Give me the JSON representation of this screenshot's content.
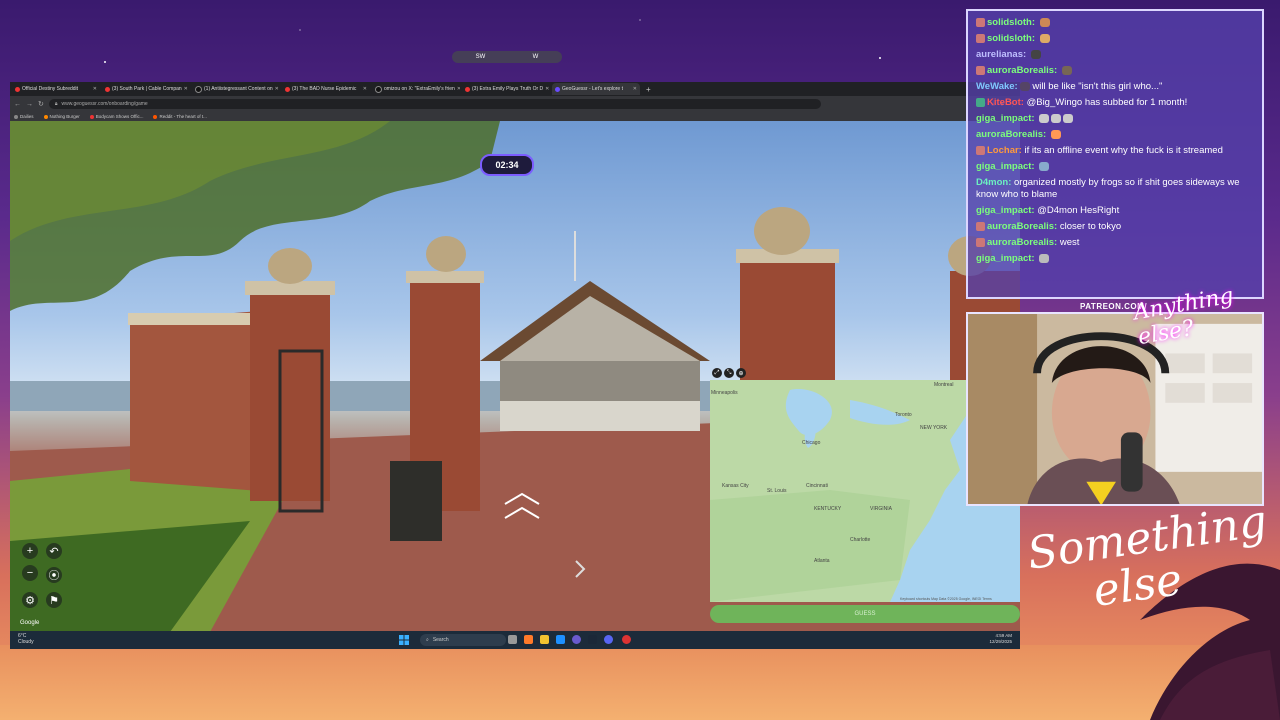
{
  "browser": {
    "tabs": [
      {
        "label": "Official Destiny Subreddit"
      },
      {
        "label": "(3) South Park | Cable Compan"
      },
      {
        "label": "(1) Antiistegressant Content on"
      },
      {
        "label": "(3) The BAD Nurse Epidemic"
      },
      {
        "label": "omizou on X: \"ExtraEmily's frien"
      },
      {
        "label": "(3) Extra Emily Plays Truth Or D"
      },
      {
        "label": "GeoGuessr - Let's explore t"
      }
    ],
    "url": "www.geoguessr.com/onboarding/game",
    "bookmarks": [
      {
        "label": "Dailies"
      },
      {
        "label": "Nothing Burger"
      },
      {
        "label": "Bodycam Shows Offic..."
      },
      {
        "label": "Reddit - The heart of t..."
      }
    ]
  },
  "game": {
    "compass_label": "SW",
    "compass_right": "W",
    "timer": "02:34",
    "guess_label": "GUESS",
    "google_logo": "Google",
    "map_labels": [
      {
        "label": "Chicago"
      },
      {
        "label": "Toronto"
      },
      {
        "label": "Montreal"
      },
      {
        "label": "NEW YORK"
      },
      {
        "label": "Kansas City"
      },
      {
        "label": "St. Louis"
      },
      {
        "label": "Cincinnati"
      },
      {
        "label": "KENTUCKY"
      },
      {
        "label": "VIRGINIA"
      },
      {
        "label": "Charlotte"
      },
      {
        "label": "Atlanta"
      },
      {
        "label": "Minneapolis"
      }
    ],
    "map_footer": "Keyboard shortcuts   Map Data ©2025 Google, INEGI   Terms"
  },
  "taskbar": {
    "weather_temp": "6°C",
    "weather_desc": "Cloudy",
    "search_placeholder": "Search",
    "time": "4:59 AM",
    "date": "12/29/2025"
  },
  "chat": {
    "messages": [
      {
        "user": "solidsloth:",
        "color": "#7cff7c",
        "text": ""
      },
      {
        "user": "solidsloth:",
        "color": "#7cff7c",
        "text": ""
      },
      {
        "user": "aurelianas:",
        "color": "#bfbfff",
        "text": ""
      },
      {
        "user": "auroraBorealis:",
        "color": "#7cff7c",
        "text": ""
      },
      {
        "user": "WeWake:",
        "color": "#80c8ff",
        "text": "will be like \"isn't this girl who...\""
      },
      {
        "user": "",
        "color": "#7cff7c",
        "text": "@Big_Wingo has subbed for 1 month!"
      },
      {
        "user": "giga_impact:",
        "color": "#7cff7c",
        "text": ""
      },
      {
        "user": "auroraBorealis:",
        "color": "#7cff7c",
        "text": ""
      },
      {
        "user": "Lochar:",
        "color": "#ff9a3c",
        "text": "if its an offline event why the fuck is it streamed"
      },
      {
        "user": "giga_impact:",
        "color": "#7cff7c",
        "text": ""
      },
      {
        "user": "D4mon:",
        "color": "#6cf0c0",
        "text": "organized mostly by frogs so if shit goes sideways we know who to blame"
      },
      {
        "user": "giga_impact:",
        "color": "#7cff7c",
        "text": "@D4mon HesRight"
      },
      {
        "user": "auroraBorealis:",
        "color": "#7cff7c",
        "text": "closer to tokyo"
      },
      {
        "user": "auroraBorealis:",
        "color": "#7cff7c",
        "text": "west"
      },
      {
        "user": "giga_impact:",
        "color": "#7cff7c",
        "text": ""
      }
    ]
  },
  "overlay": {
    "patreon": "PATREON.COM/",
    "brand_small": "Anything else?",
    "brand_large_1": "Something",
    "brand_large_2": "else"
  }
}
